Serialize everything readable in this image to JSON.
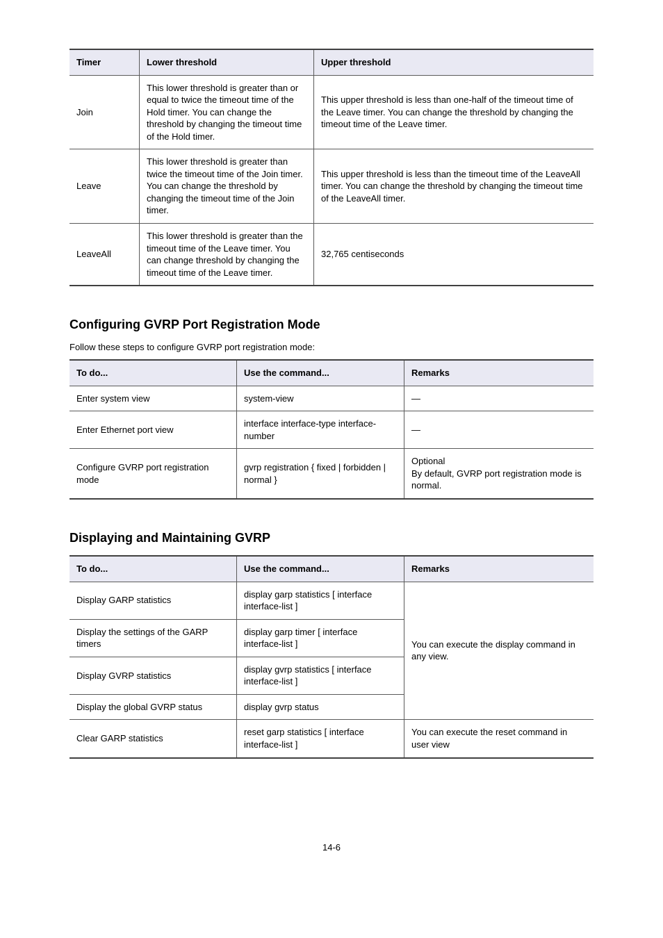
{
  "table1": {
    "headers": [
      "Timer",
      "Lower threshold",
      "Upper threshold"
    ],
    "rows": [
      {
        "timer": "Join",
        "lower": "This lower threshold is greater than or equal to twice the timeout time of the Hold timer. You can change the threshold by changing the timeout time of the Hold timer.",
        "upper": "This upper threshold is less than one-half of the timeout time of the Leave timer. You can change the threshold by changing the timeout time of the Leave timer."
      },
      {
        "timer": "Leave",
        "lower": "This lower threshold is greater than twice the timeout time of the Join timer. You can change the threshold by changing the timeout time of the Join timer.",
        "upper": "This upper threshold is less than the timeout time of the LeaveAll timer. You can change the threshold by changing the timeout time of the LeaveAll timer."
      },
      {
        "timer": "LeaveAll",
        "lower": "This lower threshold is greater than the timeout time of the Leave timer. You can change threshold by changing the timeout time of the Leave timer.",
        "upper": "32,765 centiseconds"
      }
    ]
  },
  "section2_heading": "Configuring GVRP Port Registration Mode",
  "section2_intro": "Follow these steps to configure GVRP port registration mode:",
  "table2": {
    "headers": [
      "To do...",
      "Use the command...",
      "Remarks"
    ],
    "rows": [
      {
        "todo": "Enter system view",
        "cmd": "system-view",
        "remarks": "—"
      },
      {
        "todo": "Enter Ethernet port view",
        "cmd": "interface interface-type interface-number",
        "remarks": "—"
      },
      {
        "todo": "Configure GVRP port registration mode",
        "cmd": "gvrp registration { fixed | forbidden | normal }",
        "remarks": "Optional\nBy default, GVRP port registration mode is normal."
      }
    ]
  },
  "section3_heading": "Displaying and Maintaining GVRP",
  "table3": {
    "headers": [
      "To do...",
      "Use the command...",
      "Remarks"
    ],
    "rows": [
      {
        "todo": "Display GARP statistics",
        "cmd": "display garp statistics [ interface interface-list ]"
      },
      {
        "todo": "Display the settings of the GARP timers",
        "cmd": "display garp timer [ interface interface-list ]"
      },
      {
        "todo": "Display GVRP statistics",
        "cmd": "display gvrp statistics [ interface interface-list ]"
      },
      {
        "todo": "Display the global GVRP status",
        "cmd": "display gvrp status"
      }
    ],
    "merged_remarks": "You can execute the display command in any view.",
    "last_row": {
      "todo": "Clear GARP statistics",
      "cmd": "reset garp statistics [ interface interface-list ]",
      "remarks": "You can execute the reset command in user view"
    }
  },
  "page_number": "14-6"
}
